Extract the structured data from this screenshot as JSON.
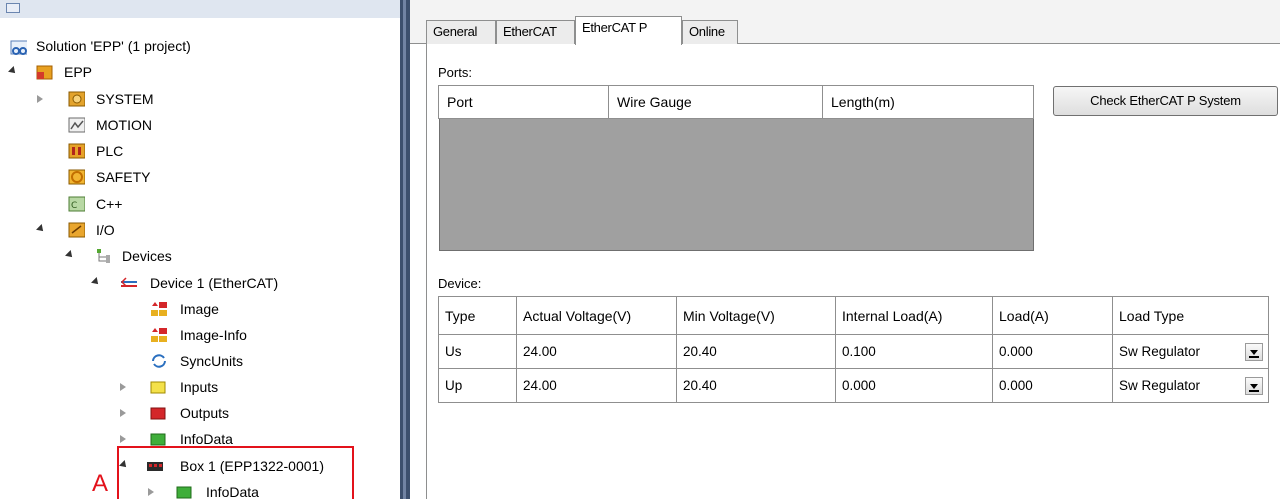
{
  "tree": {
    "items": [
      {
        "label": "Solution 'EPP' (1 project)",
        "icon": "solution-icon"
      },
      {
        "label": "EPP",
        "icon": "project-icon"
      },
      {
        "label": "SYSTEM",
        "icon": "system-icon"
      },
      {
        "label": "MOTION",
        "icon": "motion-icon"
      },
      {
        "label": "PLC",
        "icon": "plc-icon"
      },
      {
        "label": "SAFETY",
        "icon": "safety-icon"
      },
      {
        "label": "C++",
        "icon": "cpp-icon"
      },
      {
        "label": "I/O",
        "icon": "io-icon"
      },
      {
        "label": "Devices",
        "icon": "devices-icon"
      },
      {
        "label": "Device 1 (EtherCAT)",
        "icon": "ethercat-device-icon"
      },
      {
        "label": "Image",
        "icon": "image-icon"
      },
      {
        "label": "Image-Info",
        "icon": "image-info-icon"
      },
      {
        "label": "SyncUnits",
        "icon": "syncunits-icon"
      },
      {
        "label": "Inputs",
        "icon": "inputs-icon"
      },
      {
        "label": "Outputs",
        "icon": "outputs-icon"
      },
      {
        "label": "InfoData",
        "icon": "infodata-icon"
      },
      {
        "label": "Box 1 (EPP1322-0001)",
        "icon": "box-icon"
      },
      {
        "label": "InfoData",
        "icon": "infodata-icon"
      }
    ],
    "annotation": "A",
    "highlight_color": "#e3121b"
  },
  "tabs": [
    "General",
    "EtherCAT",
    "EtherCAT P",
    "Online"
  ],
  "active_tab": "EtherCAT P",
  "ports": {
    "group_label": "Ports:",
    "columns": [
      "Port",
      "Wire Gauge",
      "Length(m)"
    ],
    "rows": []
  },
  "check_button": "Check EtherCAT P System",
  "device": {
    "group_label": "Device:",
    "columns": [
      "Type",
      "Actual Voltage(V)",
      "Min Voltage(V)",
      "Internal Load(A)",
      "Load(A)",
      "Load Type"
    ],
    "rows": [
      [
        "Us",
        "24.00",
        "20.40",
        "0.100",
        "0.000",
        "Sw Regulator"
      ],
      [
        "Up",
        "24.00",
        "20.40",
        "0.000",
        "0.000",
        "Sw Regulator"
      ]
    ]
  }
}
